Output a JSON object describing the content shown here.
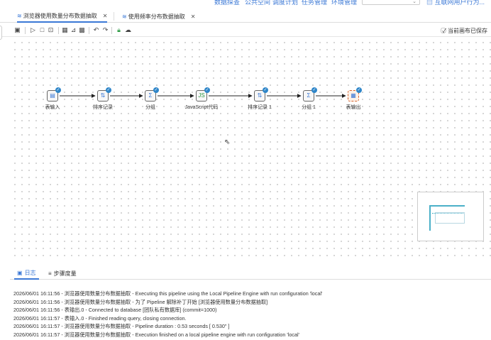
{
  "topnav": {
    "items": [
      "数据探查",
      "公共空间",
      "调度计划",
      "任务管理",
      "环境管理"
    ],
    "select_caret": "⌄",
    "user_label": "互联网用户行为..."
  },
  "tabs": [
    {
      "label": "浏览器使用数量分布数据抽取",
      "close": "✕",
      "active": true
    },
    {
      "label": "使用频率分布数据抽取",
      "close": "✕",
      "active": false
    }
  ],
  "toolbar": {
    "save_status": "当前画布已保存"
  },
  "flow": {
    "nodes": [
      {
        "label": "表输入",
        "glyph": "▤",
        "style": "default"
      },
      {
        "label": "排序记录",
        "glyph": "⇅",
        "style": "default"
      },
      {
        "label": "分组",
        "glyph": "Σ",
        "style": "default"
      },
      {
        "label": "JavaScript代码",
        "glyph": "JS",
        "style": "green"
      },
      {
        "label": "排序记录 1",
        "glyph": "⇅",
        "style": "default"
      },
      {
        "label": "分组 1",
        "glyph": "Σ",
        "style": "default"
      },
      {
        "label": "表输出",
        "glyph": "▦",
        "style": "selected"
      }
    ],
    "accent_color": "#3b78d6",
    "check_color": "#2f86c9"
  },
  "log_panel": {
    "tabs": [
      {
        "label": "日志",
        "icon": "▣",
        "active": true
      },
      {
        "label": "步骤度量",
        "icon": "≡",
        "active": false
      }
    ],
    "lines": [
      "2026/06/01 16:11:56 - 浏览器使用数量分布数据抽取 - Executing this pipeline using the Local Pipeline Engine with run configuration 'local'",
      "2026/06/01 16:11:56 - 浏览器使用数量分布数据抽取 - 为了 Pipeline 解除补丁开始 [浏览器使用数量分布数据抽取]",
      "2026/06/01 16:11:56 - 表输出.0 - Connected to database [团队私有数据库] (commit=1000)",
      "2026/06/01 16:11:57 - 表输入.0 - Finished reading query, closing connection.",
      "2026/06/01 16:11:57 - 浏览器使用数量分布数据抽取 - Pipeline duration : 0.53 seconds [  0.530\" ]",
      "2026/06/01 16:11:57 - 浏览器使用数量分布数据抽取 - Execution finished on a local pipeline engine with run configuration 'local'"
    ]
  }
}
